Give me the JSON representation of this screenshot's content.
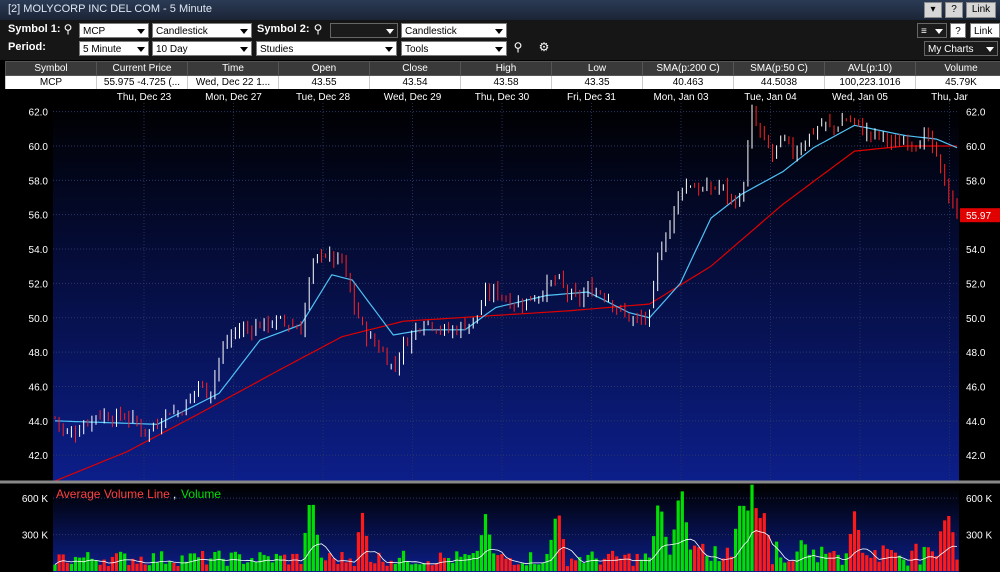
{
  "window": {
    "title": "[2] MOLYCORP INC DEL COM - 5 Minute"
  },
  "toolbar": {
    "symbol1_label": "Symbol 1:",
    "symbol1_value": "MCP",
    "chart_type1": "Candlestick",
    "symbol2_label": "Symbol 2:",
    "symbol2_value": "",
    "chart_type2": "Candlestick",
    "period_label": "Period:",
    "period_value": "5 Minute",
    "range_value": "10 Day",
    "studies_value": "Studies",
    "tools_value": "Tools",
    "link_label": "Link",
    "help_label": "?",
    "mycharts_value": "My Charts"
  },
  "quote": {
    "headers": [
      "Symbol",
      "Current Price",
      "Time",
      "Open",
      "Close",
      "High",
      "Low",
      "SMA(p:200 C)",
      "SMA(p:50 C)",
      "AVL(p:10)",
      "Volume"
    ],
    "values": [
      "MCP",
      "55.975 -4.725 (...",
      "Wed, Dec 22 1...",
      "43.55",
      "43.54",
      "43.58",
      "43.35",
      "40.463",
      "44.5038",
      "100,223.1016",
      "45.79K"
    ]
  },
  "colors": {
    "up_candle": "#ffffff",
    "down_candle": "#ff2020",
    "sma50": "#4fc3f7",
    "sma200": "#e00000",
    "vol_up": "#00e000",
    "vol_down": "#ff1a1a"
  },
  "chart_data": [
    {
      "type": "candlestick",
      "title": "",
      "x_tick_labels": [
        "Thu, Dec 23",
        "Mon, Dec 27",
        "Tue, Dec 28",
        "Wed, Dec 29",
        "Thu, Dec 30",
        "Fri, Dec 31",
        "Mon, Jan 03",
        "Tue, Jan 04",
        "Wed, Jan 05",
        "Thu, Jar"
      ],
      "y_tick_labels": [
        "42.0",
        "44.0",
        "46.0",
        "48.0",
        "50.0",
        "52.0",
        "54.0",
        "56.0",
        "58.0",
        "60.0",
        "62.0"
      ],
      "ylim": [
        40.5,
        62.5
      ],
      "last_price_label": "55.97",
      "series": [
        {
          "name": "Price",
          "close_path": [
            [
              0,
              44.2
            ],
            [
              2,
              43.2
            ],
            [
              4,
              43.4
            ],
            [
              6,
              43.9
            ],
            [
              8,
              44.4
            ],
            [
              10,
              44.3
            ],
            [
              12,
              44.2
            ],
            [
              14,
              44.3
            ],
            [
              16,
              43.8
            ],
            [
              18,
              43.3
            ],
            [
              20,
              43.9
            ],
            [
              22,
              44.6
            ],
            [
              24,
              44.5
            ],
            [
              26,
              45.1
            ],
            [
              28,
              46.2
            ],
            [
              30,
              45.5
            ],
            [
              32,
              47.6
            ],
            [
              34,
              48.9
            ],
            [
              36,
              49.3
            ],
            [
              38,
              49.4
            ],
            [
              40,
              49.6
            ],
            [
              42,
              49.7
            ],
            [
              44,
              49.8
            ],
            [
              46,
              49.6
            ],
            [
              48,
              49.3
            ],
            [
              50,
              52.8
            ],
            [
              52,
              53.9
            ],
            [
              54,
              53.4
            ],
            [
              56,
              53.3
            ],
            [
              58,
              51.0
            ],
            [
              60,
              49.4
            ],
            [
              62,
              48.6
            ],
            [
              64,
              48.0
            ],
            [
              66,
              47.0
            ],
            [
              68,
              48.4
            ],
            [
              70,
              49.2
            ],
            [
              72,
              49.9
            ],
            [
              74,
              49.6
            ],
            [
              76,
              49.2
            ],
            [
              78,
              49.3
            ],
            [
              80,
              49.6
            ],
            [
              82,
              49.9
            ],
            [
              84,
              51.3
            ],
            [
              86,
              51.6
            ],
            [
              88,
              51.1
            ],
            [
              90,
              50.8
            ],
            [
              92,
              51.0
            ],
            [
              94,
              51.3
            ],
            [
              96,
              51.8
            ],
            [
              98,
              52.3
            ],
            [
              100,
              51.4
            ],
            [
              102,
              51.0
            ],
            [
              104,
              51.6
            ],
            [
              106,
              51.6
            ],
            [
              108,
              51.2
            ],
            [
              110,
              50.4
            ],
            [
              112,
              50.0
            ],
            [
              114,
              49.8
            ],
            [
              116,
              50.1
            ],
            [
              118,
              54.1
            ],
            [
              120,
              55.4
            ],
            [
              122,
              57.6
            ],
            [
              124,
              57.8
            ],
            [
              126,
              57.4
            ],
            [
              128,
              57.5
            ],
            [
              130,
              57.7
            ],
            [
              132,
              56.8
            ],
            [
              134,
              56.9
            ],
            [
              136,
              61.8
            ],
            [
              138,
              60.4
            ],
            [
              140,
              59.5
            ],
            [
              142,
              60.4
            ],
            [
              144,
              59.6
            ],
            [
              146,
              60.2
            ],
            [
              148,
              60.9
            ],
            [
              150,
              61.3
            ],
            [
              152,
              61.0
            ],
            [
              154,
              61.6
            ],
            [
              156,
              61.4
            ],
            [
              158,
              60.8
            ],
            [
              160,
              60.6
            ],
            [
              162,
              60.5
            ],
            [
              164,
              60.0
            ],
            [
              166,
              60.4
            ],
            [
              168,
              60.2
            ],
            [
              170,
              60.6
            ],
            [
              172,
              59.3
            ],
            [
              174,
              57.5
            ],
            [
              176,
              55.97
            ]
          ]
        },
        {
          "name": "SMA(p:50 C)",
          "path": [
            [
              0,
              44.0
            ],
            [
              20,
              43.8
            ],
            [
              32,
              45.6
            ],
            [
              40,
              48.7
            ],
            [
              48,
              49.6
            ],
            [
              54,
              52.5
            ],
            [
              58,
              52.2
            ],
            [
              66,
              49.0
            ],
            [
              72,
              49.3
            ],
            [
              80,
              49.3
            ],
            [
              86,
              50.6
            ],
            [
              96,
              51.3
            ],
            [
              104,
              51.5
            ],
            [
              112,
              50.3
            ],
            [
              116,
              50.0
            ],
            [
              122,
              52.0
            ],
            [
              128,
              55.8
            ],
            [
              134,
              57.2
            ],
            [
              142,
              58.5
            ],
            [
              148,
              59.9
            ],
            [
              156,
              61.2
            ],
            [
              166,
              60.6
            ],
            [
              172,
              60.4
            ],
            [
              176,
              59.9
            ]
          ]
        },
        {
          "name": "SMA(p:200 C)",
          "path": [
            [
              0,
              40.5
            ],
            [
              14,
              42.2
            ],
            [
              28,
              44.4
            ],
            [
              44,
              47.0
            ],
            [
              56,
              48.9
            ],
            [
              68,
              49.8
            ],
            [
              84,
              50.1
            ],
            [
              100,
              50.4
            ],
            [
              116,
              50.8
            ],
            [
              128,
              53.0
            ],
            [
              142,
              56.6
            ],
            [
              156,
              59.7
            ],
            [
              166,
              60.0
            ],
            [
              176,
              60.0
            ]
          ]
        }
      ]
    },
    {
      "type": "bar",
      "title": "",
      "legend": [
        "Average Volume Line",
        "Volume"
      ],
      "y_tick_labels": [
        "300 K",
        "600 K"
      ],
      "ylim": [
        0,
        700000
      ],
      "spikes": [
        [
          50,
          620000
        ],
        [
          60,
          450000
        ],
        [
          84,
          450000
        ],
        [
          98,
          520000
        ],
        [
          118,
          520000
        ],
        [
          122,
          680000
        ],
        [
          134,
          580000
        ],
        [
          136,
          700000
        ],
        [
          138,
          480000
        ],
        [
          156,
          400000
        ],
        [
          174,
          500000
        ]
      ]
    }
  ]
}
